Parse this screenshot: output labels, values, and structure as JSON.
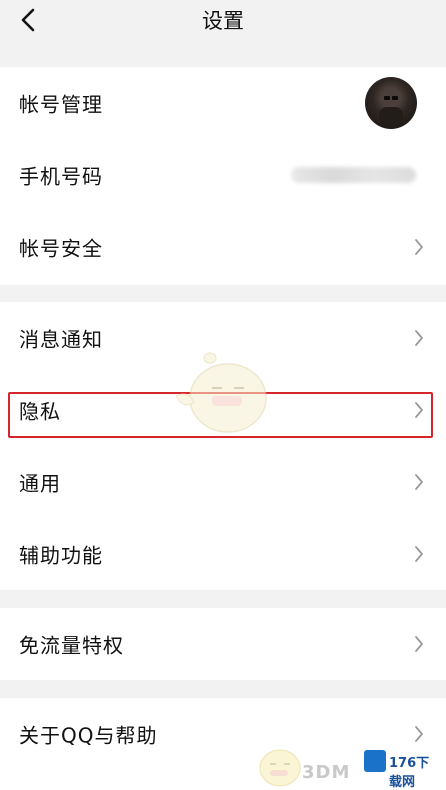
{
  "header": {
    "title": "设置"
  },
  "sections": [
    {
      "rows": [
        {
          "label": "帐号管理",
          "trailing": "avatar"
        },
        {
          "label": "手机号码",
          "trailing": "masked"
        },
        {
          "label": "帐号安全",
          "trailing": "chevron"
        }
      ]
    },
    {
      "rows": [
        {
          "label": "消息通知",
          "trailing": "chevron"
        },
        {
          "label": "隐私",
          "trailing": "chevron",
          "highlighted": true
        },
        {
          "label": "通用",
          "trailing": "chevron"
        },
        {
          "label": "辅助功能",
          "trailing": "chevron"
        }
      ]
    },
    {
      "rows": [
        {
          "label": "免流量特权",
          "trailing": "chevron"
        }
      ]
    },
    {
      "rows": [
        {
          "label": "关于QQ与帮助",
          "trailing": "chevron"
        }
      ]
    }
  ],
  "watermark": {
    "text": "3DM",
    "logo_text": "176下载网"
  },
  "colors": {
    "highlight": "#d7262b",
    "background": "#f2f2f2",
    "card": "#ffffff"
  }
}
